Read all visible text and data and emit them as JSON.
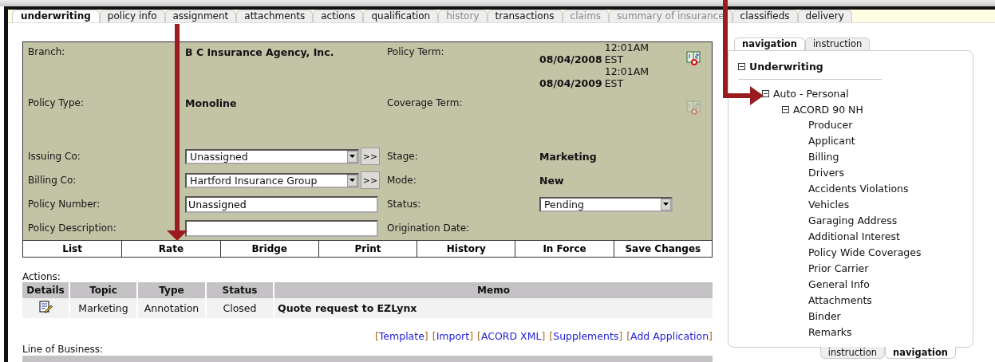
{
  "tabs": [
    {
      "label": "underwriting",
      "selected": true,
      "disabled": false
    },
    {
      "label": "policy info",
      "selected": false,
      "disabled": false
    },
    {
      "label": "assignment",
      "selected": false,
      "disabled": false
    },
    {
      "label": "attachments",
      "selected": false,
      "disabled": false
    },
    {
      "label": "actions",
      "selected": false,
      "disabled": false
    },
    {
      "label": "qualification",
      "selected": false,
      "disabled": false
    },
    {
      "label": "history",
      "selected": false,
      "disabled": true
    },
    {
      "label": "transactions",
      "selected": false,
      "disabled": false
    },
    {
      "label": "claims",
      "selected": false,
      "disabled": true
    },
    {
      "label": "summary of insurance",
      "selected": false,
      "disabled": true
    },
    {
      "label": "classifieds",
      "selected": false,
      "disabled": false
    },
    {
      "label": "delivery",
      "selected": false,
      "disabled": false
    }
  ],
  "form": {
    "rows": [
      {
        "label": "Branch:",
        "value": {
          "kind": "bold",
          "text": "B C Insurance Agency, Inc."
        },
        "label2": "Policy Term:",
        "value2": {
          "kind": "term",
          "entries": [
            {
              "date": "08/04/2008",
              "time": "12:01AM EST"
            },
            {
              "date": "08/04/2009",
              "time": "12:01AM EST"
            }
          ]
        },
        "calendar": {
          "disabled": false
        }
      },
      {
        "label": "Policy Type:",
        "value": {
          "kind": "bold",
          "text": "Monoline"
        },
        "label2": "Coverage Term:",
        "value2": {
          "kind": "empty"
        },
        "calendar": {
          "disabled": true
        }
      },
      {
        "label": "Issuing Co:",
        "value": {
          "kind": "select",
          "text": "Unassigned",
          "more": ">>"
        },
        "label2": "Stage:",
        "value2": {
          "kind": "bold",
          "text": "Marketing"
        }
      },
      {
        "label": "Billing Co:",
        "value": {
          "kind": "select",
          "text": "Hartford Insurance Group",
          "more": ">>"
        },
        "label2": "Mode:",
        "value2": {
          "kind": "bold",
          "text": "New"
        }
      },
      {
        "label": "Policy Number:",
        "value": {
          "kind": "input",
          "text": "Unassigned"
        },
        "label2": "Status:",
        "value2": {
          "kind": "select",
          "text": "Pending"
        }
      },
      {
        "label": "Policy Description:",
        "value": {
          "kind": "input"
        },
        "label2": "Origination Date:",
        "value2": {
          "kind": "empty"
        }
      }
    ],
    "buttons": [
      "List",
      "Rate",
      "Bridge",
      "Print",
      "History",
      "In Force",
      "Save Changes"
    ]
  },
  "actions": {
    "label": "Actions:",
    "columns": [
      "Details",
      "Topic",
      "Type",
      "Status",
      "Memo"
    ],
    "rows": [
      {
        "topic": "Marketing",
        "type": "Annotation",
        "status": "Closed",
        "memo": "Quote request to EZLynx"
      }
    ]
  },
  "links": [
    {
      "open": "[",
      "text": "Template",
      "close": "]"
    },
    {
      "open": "[",
      "text": "Import",
      "close": "]"
    },
    {
      "open": "[",
      "text": "ACORD XML",
      "close": "]"
    },
    {
      "open": "[",
      "text": "Supplements",
      "close": "]"
    },
    {
      "open": "[",
      "text": "Add Application",
      "close": "]"
    }
  ],
  "line_of_business": {
    "label": "Line of Business:"
  },
  "side_panel": {
    "tabs": [
      {
        "label": "navigation",
        "selected": true
      },
      {
        "label": "instruction",
        "selected": false
      }
    ],
    "tree": {
      "label": "Underwriting",
      "expanded": true,
      "children": [
        {
          "label": "Auto - Personal",
          "expanded": true,
          "children": [
            {
              "label": "ACORD 90 NH",
              "expanded": true,
              "children": [
                {
                  "label": "Producer"
                },
                {
                  "label": "Applicant"
                },
                {
                  "label": "Billing"
                },
                {
                  "label": "Drivers"
                },
                {
                  "label": "Accidents Violations"
                },
                {
                  "label": "Vehicles"
                },
                {
                  "label": "Garaging Address"
                },
                {
                  "label": "Additional Interest"
                },
                {
                  "label": "Policy Wide Coverages"
                },
                {
                  "label": "Prior Carrier"
                },
                {
                  "label": "General Info"
                },
                {
                  "label": "Attachments"
                },
                {
                  "label": "Binder"
                },
                {
                  "label": "Remarks"
                }
              ]
            }
          ]
        }
      ]
    },
    "bottom_tabs": [
      {
        "label": "instruction",
        "selected": false
      },
      {
        "label": "navigation",
        "selected": true
      }
    ]
  }
}
